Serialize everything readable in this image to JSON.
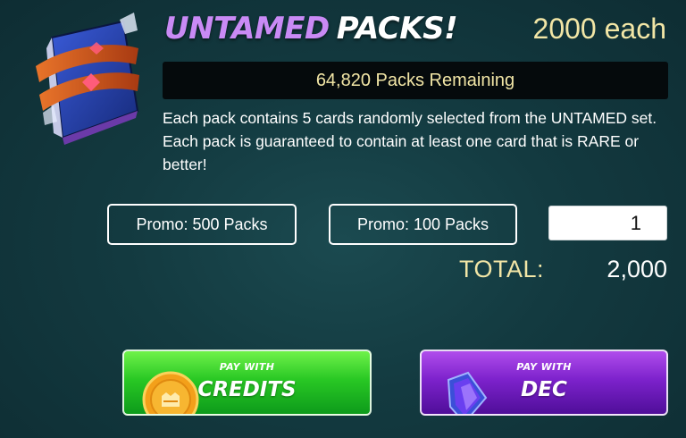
{
  "header": {
    "title_part1": "UNTAMED",
    "title_part2": "PACKS!",
    "price": "2000 each"
  },
  "remaining": "64,820 Packs Remaining",
  "description": "Each pack contains 5 cards randomly selected from the UNTAMED set. Each pack is guaranteed to contain at least one card that is RARE or better!",
  "promos": [
    {
      "label": "Promo: 500 Packs"
    },
    {
      "label": "Promo: 100 Packs"
    }
  ],
  "quantity": {
    "value": "1"
  },
  "total": {
    "label": "TOTAL:",
    "value": "2,000"
  },
  "pay_buttons": {
    "credits": {
      "small": "PAY WITH",
      "big": "CREDITS",
      "icon": "credits-coin-icon"
    },
    "dec": {
      "small": "PAY WITH",
      "big": "DEC",
      "icon": "dec-shard-icon"
    }
  },
  "colors": {
    "title_accent": "#c98af5",
    "gold_text": "#f2e6a6",
    "credits_green": "#29c824",
    "dec_purple": "#7d22cc",
    "background": "#133a40"
  }
}
